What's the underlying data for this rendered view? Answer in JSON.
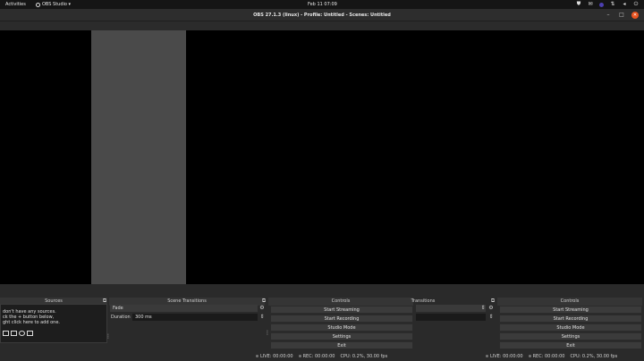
{
  "topbar": {
    "activities": "Activities",
    "app_name": "OBS Studio ▾",
    "clock": "Feb 11  07:09"
  },
  "window": {
    "title": "OBS 27.1.3 (linux) - Profile: Untitled - Scenes: Untitled"
  },
  "docks": {
    "sources_title": "Sources",
    "scene_transitions_title": "Scene Transitions",
    "controls_title": "Controls",
    "transitions_title": "Transitions",
    "controls2_title": "Controls"
  },
  "sources": {
    "empty_lines": [
      "don't have any sources.",
      "ck the + button below,",
      "ght click here to add one."
    ]
  },
  "scene_transitions": {
    "selected": "Fade",
    "duration_label": "Duration",
    "duration_value": "300 ms"
  },
  "controls": {
    "buttons": [
      "Start Streaming",
      "Start Recording",
      "Studio Mode",
      "Settings",
      "Exit"
    ]
  },
  "controls2": {
    "buttons": [
      "Start Streaming",
      "Start Recording",
      "Studio Mode",
      "Settings",
      "Exit"
    ]
  },
  "status": {
    "live": "LIVE: 00:00:00",
    "rec": "REC: 00:00:00",
    "cpu": "CPU: 0.2%, 30.00 fps"
  },
  "colors": {
    "close_button": "#e95420",
    "apps_indicator": "#4c3fb0"
  }
}
